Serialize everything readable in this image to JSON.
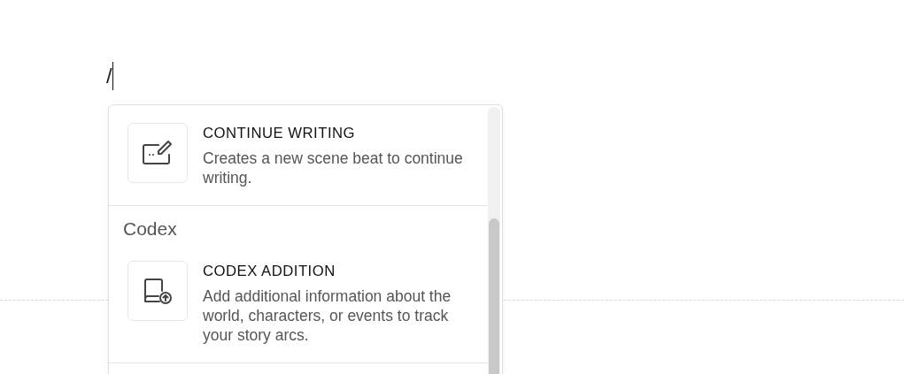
{
  "editor": {
    "text": "/"
  },
  "menu": {
    "sections": [
      {
        "items": [
          {
            "kind": "pencil-card",
            "title": "CONTINUE WRITING",
            "description": "Creates a new scene beat to continue writing."
          }
        ]
      },
      {
        "heading": "Codex",
        "items": [
          {
            "kind": "book-upload",
            "title": "CODEX ADDITION",
            "description": "Add additional information about the world, characters, or events to track your story arcs."
          }
        ]
      }
    ]
  }
}
